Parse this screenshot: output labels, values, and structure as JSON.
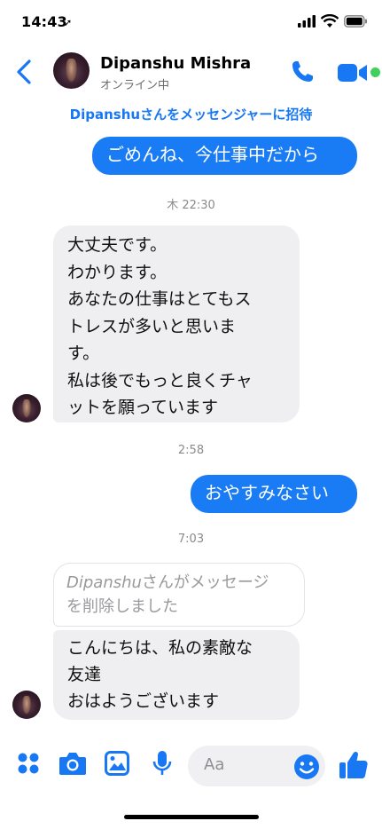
{
  "status_bar": {
    "time": "14:43"
  },
  "header": {
    "contact_name": "Dipanshu Mishra",
    "presence": "オンライン中"
  },
  "invite_link": "Dipanshuさんをメッセンジャーに招待",
  "messages": {
    "m1": "ごめんね、今仕事中だから",
    "ts1": "木 22:30",
    "m2_lines": [
      "大丈夫です。",
      "わかります。",
      "あなたの仕事はとてもス",
      "トレスが多いと思いま",
      "す。",
      "私は後でもっと良くチャ",
      "ットを願っています"
    ],
    "ts2": "2:58",
    "m3": "おやすみなさい",
    "ts3": "7:03",
    "deleted_name": "Dipanshu",
    "deleted_rest_1": "さんがメッセージ",
    "deleted_rest_2": "を削除しました",
    "m4_lines": [
      "こんにちは、私の素敵な",
      "友達",
      "おはようございます"
    ]
  },
  "composer": {
    "placeholder": "Aa"
  },
  "colors": {
    "accent": "#1877f2",
    "outgoing_bubble": "#1a7cf5",
    "incoming_bubble": "#efeff1",
    "online": "#3fd15b"
  },
  "icons": [
    "back-icon",
    "phone-icon",
    "video-icon",
    "apps-icon",
    "camera-icon",
    "gallery-icon",
    "microphone-icon",
    "emoji-icon",
    "thumbs-up-icon"
  ]
}
